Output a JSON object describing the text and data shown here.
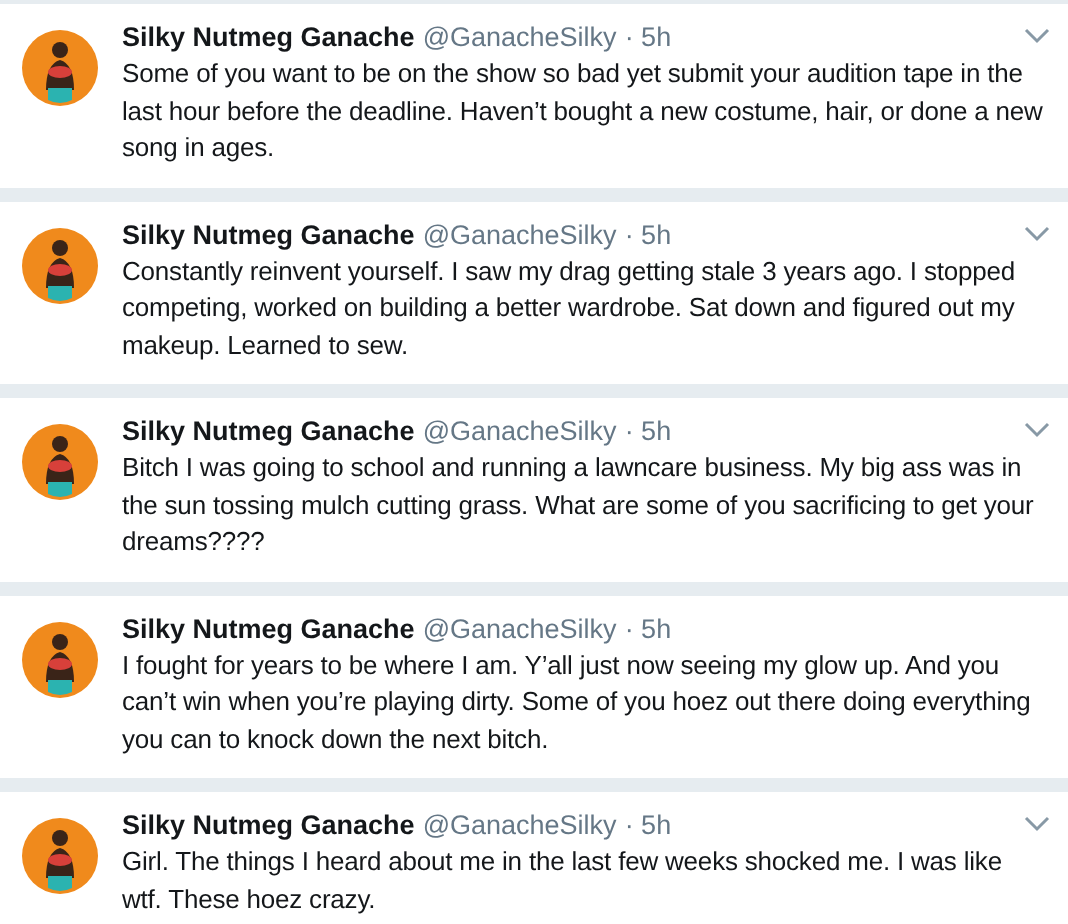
{
  "tweets": [
    {
      "name": "Silky Nutmeg Ganache",
      "handle": "@GanacheSilky",
      "time": "· 5h",
      "menu": true,
      "text": "Some of you want to be on the show so bad yet submit your audition tape in the last hour before the deadline. Haven’t bought a new costume, hair, or done a new song in ages."
    },
    {
      "name": "Silky Nutmeg Ganache",
      "handle": "@GanacheSilky",
      "time": "· 5h",
      "menu": true,
      "text": "Constantly reinvent yourself. I saw my drag getting stale 3 years ago. I stopped competing, worked on building a better wardrobe. Sat down and figured out my makeup. Learned to sew."
    },
    {
      "name": "Silky Nutmeg Ganache",
      "handle": "@GanacheSilky",
      "time": "· 5h",
      "menu": true,
      "text": "Bitch I was going to school and running a lawncare business. My big ass was in the sun tossing mulch cutting grass. What are some of you sacrificing to get your dreams????"
    },
    {
      "name": "Silky Nutmeg Ganache",
      "handle": "@GanacheSilky",
      "time": "· 5h",
      "menu": false,
      "text": "I fought for years to be where I am. Y’all just now seeing my glow up. And you can’t win when you’re playing dirty. Some of you hoez out there doing everything you can to knock down the next bitch."
    },
    {
      "name": "Silky Nutmeg Ganache",
      "handle": "@GanacheSilky",
      "time": "· 5h",
      "menu": true,
      "text": "Girl. The things I heard about me in the last few weeks shocked me. I was like wtf. These hoez crazy."
    }
  ]
}
